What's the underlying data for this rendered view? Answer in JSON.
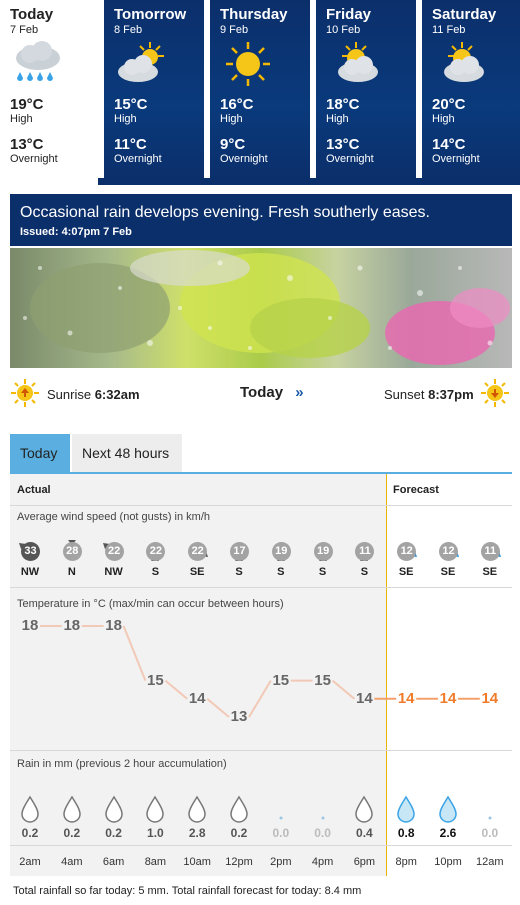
{
  "days": [
    {
      "name": "Today",
      "date": "7 Feb",
      "icon": "rain-cloud-icon",
      "high": "19°C",
      "high_label": "High",
      "low": "13°C",
      "low_label": "Overnight"
    },
    {
      "name": "Tomorrow",
      "date": "8 Feb",
      "icon": "partly-cloudy-icon",
      "high": "15°C",
      "high_label": "High",
      "low": "11°C",
      "low_label": "Overnight"
    },
    {
      "name": "Thursday",
      "date": "9 Feb",
      "icon": "sun-icon",
      "high": "16°C",
      "high_label": "High",
      "low": "9°C",
      "low_label": "Overnight"
    },
    {
      "name": "Friday",
      "date": "10 Feb",
      "icon": "partly-cloudy-icon",
      "high": "18°C",
      "high_label": "High",
      "low": "13°C",
      "low_label": "Overnight"
    },
    {
      "name": "Saturday",
      "date": "11 Feb",
      "icon": "partly-cloudy-icon",
      "high": "20°C",
      "high_label": "High",
      "low": "14°C",
      "low_label": "Overnight"
    }
  ],
  "banner": {
    "headline": "Occasional rain develops evening. Fresh southerly eases.",
    "issued": "Issued: 4:07pm 7 Feb"
  },
  "sun": {
    "sunrise_label": "Sunrise",
    "sunrise_time": "6:32am",
    "today_label": "Today",
    "sunset_label": "Sunset",
    "sunset_time": "8:37pm"
  },
  "tabs": [
    {
      "label": "Today",
      "active": true
    },
    {
      "label": "Next 48 hours",
      "active": false
    }
  ],
  "panel": {
    "actual_label": "Actual",
    "forecast_label": "Forecast",
    "wind_title": "Average wind speed (not gusts) in km/h",
    "temp_title": "Temperature in °C (max/min can occur between hours)",
    "rain_title": "Rain in mm (previous 2 hour accumulation)",
    "times": [
      "2am",
      "4am",
      "6am",
      "8am",
      "10am",
      "12pm",
      "2pm",
      "4pm",
      "6pm",
      "8pm",
      "10pm",
      "12am"
    ],
    "wind": [
      {
        "speed": "33",
        "dir": "NW",
        "forecast": false,
        "dark": true
      },
      {
        "speed": "28",
        "dir": "N",
        "forecast": false,
        "dark": false
      },
      {
        "speed": "22",
        "dir": "NW",
        "forecast": false,
        "dark": false
      },
      {
        "speed": "22",
        "dir": "S",
        "forecast": false,
        "dark": false
      },
      {
        "speed": "22",
        "dir": "SE",
        "forecast": false,
        "dark": false
      },
      {
        "speed": "17",
        "dir": "S",
        "forecast": false,
        "dark": false
      },
      {
        "speed": "19",
        "dir": "S",
        "forecast": false,
        "dark": false
      },
      {
        "speed": "19",
        "dir": "S",
        "forecast": false,
        "dark": false
      },
      {
        "speed": "11",
        "dir": "S",
        "forecast": false,
        "dark": false
      },
      {
        "speed": "12",
        "dir": "SE",
        "forecast": true,
        "dark": false
      },
      {
        "speed": "12",
        "dir": "SE",
        "forecast": true,
        "dark": false
      },
      {
        "speed": "11",
        "dir": "SE",
        "forecast": true,
        "dark": false
      }
    ],
    "temps": [
      18,
      18,
      18,
      15,
      14,
      13,
      15,
      15,
      14,
      14,
      14,
      14
    ],
    "forecast_start_index": 9,
    "rain": [
      "0.2",
      "0.2",
      "0.2",
      "1.0",
      "2.8",
      "0.2",
      "0.0",
      "0.0",
      "0.4",
      "0.8",
      "2.6",
      "0.0"
    ]
  },
  "footer": "Total rainfall so far today: 5 mm. Total rainfall forecast for today: 8.4 mm",
  "colors": {
    "navy": "#0b2f6b",
    "tab_active": "#5aaee0",
    "forecast_temp": "#f07b2a",
    "divider": "#e8b400"
  }
}
